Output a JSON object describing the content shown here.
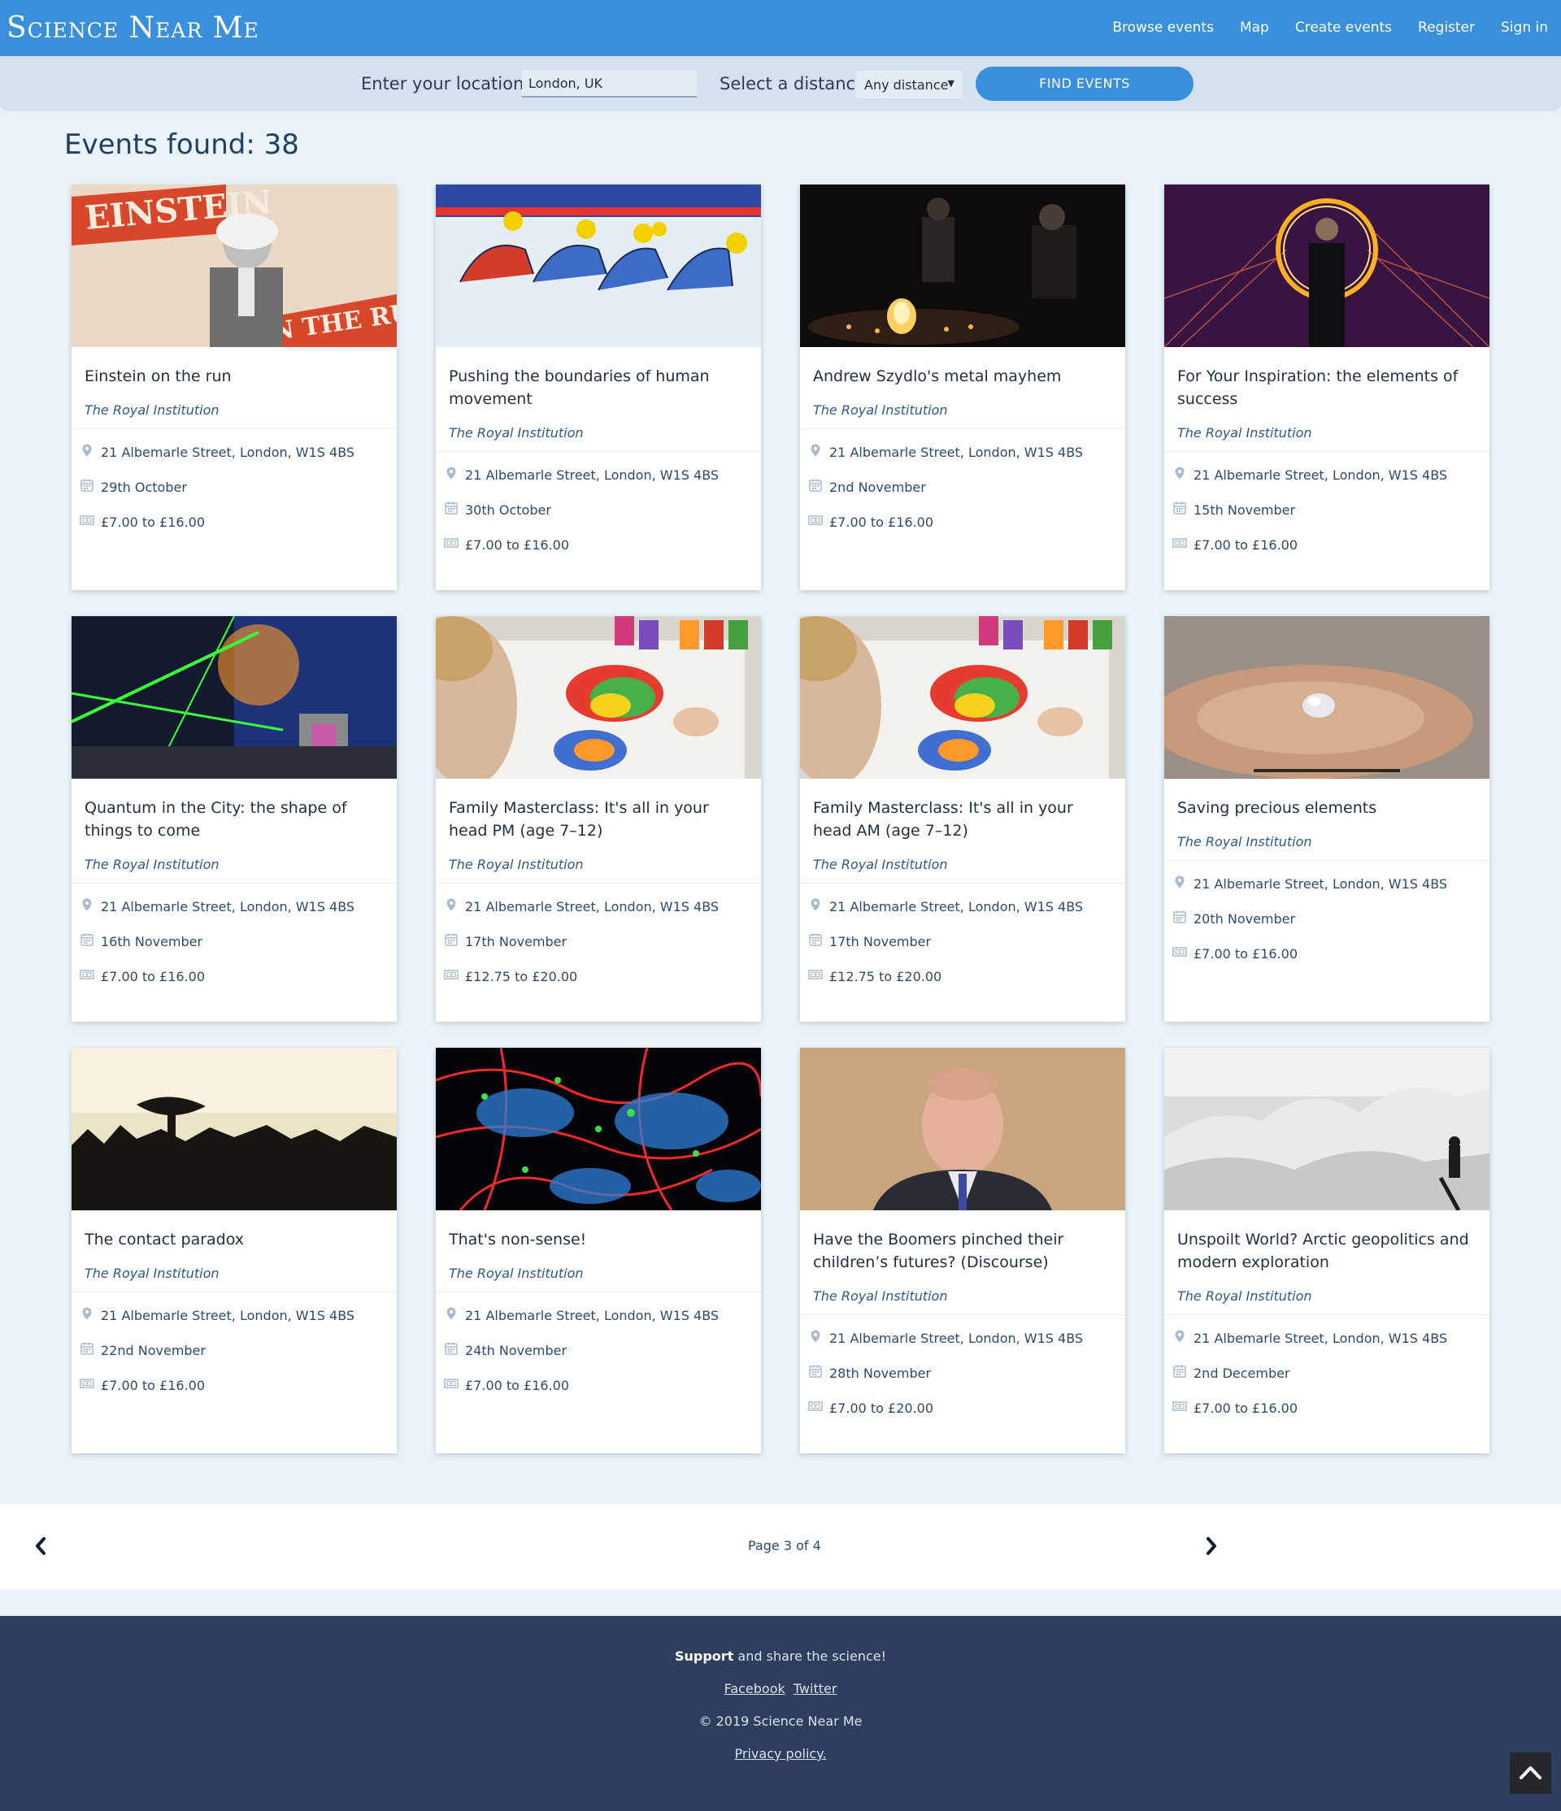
{
  "header": {
    "brand": "Science Near Me",
    "nav": [
      "Browse events",
      "Map",
      "Create events",
      "Register",
      "Sign in"
    ]
  },
  "search": {
    "location_label": "Enter your location:",
    "location_value": "London, UK",
    "distance_label": "Select a distance:",
    "distance_value": "Any distance",
    "find_label": "FIND EVENTS"
  },
  "results": {
    "count_text": "Events found: 38"
  },
  "events": [
    {
      "title": "Einstein on the run",
      "org": "The Royal Institution",
      "address": "21 Albemarle Street, London, W1S 4BS",
      "date": "29th October",
      "price": "£7.00 to £16.00",
      "image": "einstein-poster"
    },
    {
      "title": "Pushing the boundaries of human movement",
      "org": "The Royal Institution",
      "address": "21 Albemarle Street, London, W1S 4BS",
      "date": "30th October",
      "price": "£7.00 to £16.00",
      "image": "speed-skaters"
    },
    {
      "title": "Andrew Szydlo's metal mayhem",
      "org": "The Royal Institution",
      "address": "21 Albemarle Street, London, W1S 4BS",
      "date": "2nd November",
      "price": "£7.00 to £16.00",
      "image": "chemistry-demo"
    },
    {
      "title": "For Your Inspiration: the elements of success",
      "org": "The Royal Institution",
      "address": "21 Albemarle Street, London, W1S 4BS",
      "date": "15th November",
      "price": "£7.00 to £16.00",
      "image": "steel-wool-ring"
    },
    {
      "title": "Quantum in the City: the shape of things to come",
      "org": "The Royal Institution",
      "address": "21 Albemarle Street, London, W1S 4BS",
      "date": "16th November",
      "price": "£7.00 to £16.00",
      "image": "laser-lab"
    },
    {
      "title": "Family Masterclass: It's all in your head PM (age 7–12)",
      "org": "The Royal Institution",
      "address": "21 Albemarle Street, London, W1S 4BS",
      "date": "17th November",
      "price": "£12.75 to £20.00",
      "image": "child-painting"
    },
    {
      "title": "Family Masterclass: It's all in your head AM (age 7–12)",
      "org": "The Royal Institution",
      "address": "21 Albemarle Street, London, W1S 4BS",
      "date": "17th November",
      "price": "£12.75 to £20.00",
      "image": "child-painting"
    },
    {
      "title": "Saving precious elements",
      "org": "The Royal Institution",
      "address": "21 Albemarle Street, London, W1S 4BS",
      "date": "20th November",
      "price": "£7.00 to £16.00",
      "image": "hand-crystal"
    },
    {
      "title": "The contact paradox",
      "org": "The Royal Institution",
      "address": "21 Albemarle Street, London, W1S 4BS",
      "date": "22nd November",
      "price": "£7.00 to £16.00",
      "image": "radio-telescope"
    },
    {
      "title": "That's non-sense!",
      "org": "The Royal Institution",
      "address": "21 Albemarle Street, London, W1S 4BS",
      "date": "24th November",
      "price": "£7.00 to £16.00",
      "image": "neurons"
    },
    {
      "title": "Have the Boomers pinched their children’s futures? (Discourse)",
      "org": "The Royal Institution",
      "address": "21 Albemarle Street, London, W1S 4BS",
      "date": "28th November",
      "price": "£7.00 to £20.00",
      "image": "portrait"
    },
    {
      "title": "Unspoilt World? Arctic geopolitics and modern exploration",
      "org": "The Royal Institution",
      "address": "21 Albemarle Street, London, W1S 4BS",
      "date": "2nd December",
      "price": "£7.00 to £16.00",
      "image": "arctic-ice"
    }
  ],
  "pagination": {
    "text": "Page 3 of 4"
  },
  "footer": {
    "support_bold": "Support",
    "support_rest": " and share the science!",
    "links": [
      "Facebook",
      "Twitter"
    ],
    "copyright": "© 2019 Science Near Me",
    "privacy": "Privacy policy."
  },
  "colors": {
    "primary": "#3a8fdc",
    "footer": "#2d3e5f",
    "background": "#eaf2fa"
  },
  "icons": [
    "map-pin-icon",
    "calendar-icon",
    "ticket-icon",
    "chevron-left-icon",
    "chevron-right-icon",
    "chevron-up-icon"
  ]
}
